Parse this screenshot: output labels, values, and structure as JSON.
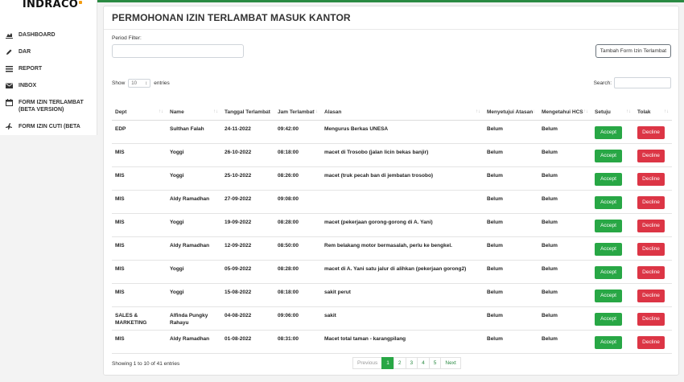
{
  "brand": {
    "logo_text": "INDRACO",
    "accent": "#f39c12"
  },
  "sidebar": {
    "items": [
      {
        "label": "DASHBOARD",
        "icon": "chart-area-icon"
      },
      {
        "label": "DAR",
        "icon": "pencil-icon"
      },
      {
        "label": "REPORT",
        "icon": "list-icon"
      },
      {
        "label": "INBOX",
        "icon": "envelope-icon"
      },
      {
        "label": "FORM IZIN TERLAMBAT (BETA VERSION)",
        "icon": "calendar-icon"
      },
      {
        "label": "FORM IZIN CUTI (BETA",
        "icon": "plane-icon"
      }
    ]
  },
  "page": {
    "title": "PERMOHONAN IZIN TERLAMBAT MASUK KANTOR",
    "filter_label": "Period Filter:",
    "filter_value": "",
    "add_button": "Tambah Form Izin Terlambat",
    "show_prefix": "Show",
    "show_value": "10",
    "show_suffix": "entries",
    "search_label": "Search:"
  },
  "table": {
    "headers": [
      "Dept",
      "Name",
      "Tanggal Terlambat",
      "Jam Terlambat",
      "Alasan",
      "Menyetujui Atasan",
      "Mengetahui HCS",
      "Setuju",
      "Tolak"
    ],
    "accept_label": "Accept",
    "decline_label": "Decline",
    "rows": [
      {
        "dept": "EDP",
        "name": "Sulthan Falah",
        "tanggal": "24-11-2022",
        "jam": "09:42:00",
        "alasan": "Mengurus Berkas UNESA",
        "atasan": "Belum",
        "hcs": "Belum"
      },
      {
        "dept": "MIS",
        "name": "Yoggi",
        "tanggal": "26-10-2022",
        "jam": "08:18:00",
        "alasan": "macet di Trosobo (jalan licin bekas banjir)",
        "atasan": "Belum",
        "hcs": "Belum"
      },
      {
        "dept": "MIS",
        "name": "Yoggi",
        "tanggal": "25-10-2022",
        "jam": "08:26:00",
        "alasan": "macet (truk pecah ban di jembatan trosobo)",
        "atasan": "Belum",
        "hcs": "Belum"
      },
      {
        "dept": "MIS",
        "name": "Aldy Ramadhan",
        "tanggal": "27-09-2022",
        "jam": "09:08:00",
        "alasan": "",
        "atasan": "Belum",
        "hcs": "Belum"
      },
      {
        "dept": "MIS",
        "name": "Yoggi",
        "tanggal": "19-09-2022",
        "jam": "08:28:00",
        "alasan": "macet (pekerjaan gorong-gorong di A. Yani)",
        "atasan": "Belum",
        "hcs": "Belum"
      },
      {
        "dept": "MIS",
        "name": "Aldy Ramadhan",
        "tanggal": "12-09-2022",
        "jam": "08:50:00",
        "alasan": "Rem belakang motor bermasalah, perlu ke bengkel.",
        "atasan": "Belum",
        "hcs": "Belum"
      },
      {
        "dept": "MIS",
        "name": "Yoggi",
        "tanggal": "05-09-2022",
        "jam": "08:28:00",
        "alasan": "macet di A. Yani satu jalur di alihkan (pekerjaan gorong2)",
        "atasan": "Belum",
        "hcs": "Belum"
      },
      {
        "dept": "MIS",
        "name": "Yoggi",
        "tanggal": "15-08-2022",
        "jam": "08:18:00",
        "alasan": "sakit perut",
        "atasan": "Belum",
        "hcs": "Belum"
      },
      {
        "dept": "SALES & MARKETING",
        "name": "Alfinda Pungky Rahayu",
        "tanggal": "04-08-2022",
        "jam": "09:06:00",
        "alasan": "sakit",
        "atasan": "Belum",
        "hcs": "Belum"
      },
      {
        "dept": "MIS",
        "name": "Aldy Ramadhan",
        "tanggal": "01-08-2022",
        "jam": "08:31:00",
        "alasan": "Macet total taman - karangpilang",
        "atasan": "Belum",
        "hcs": "Belum"
      }
    ]
  },
  "footer": {
    "info": "Showing 1 to 10 of 41 entries",
    "previous": "Previous",
    "pages": [
      "1",
      "2",
      "3",
      "4",
      "5"
    ],
    "next": "Next"
  },
  "colors": {
    "accept": "#28a745",
    "decline": "#dc3545",
    "topbar": "#2a8a42"
  }
}
